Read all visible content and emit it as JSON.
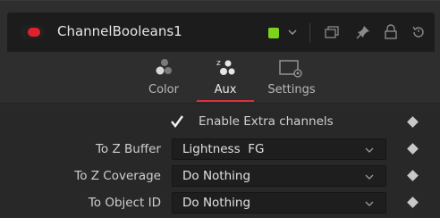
{
  "header": {
    "title": "ChannelBooleans1",
    "node_color": "#7cd31b",
    "power_color": "#e2202b",
    "icons": [
      "power-toggle",
      "color-swatch",
      "chevron-down-icon",
      "versions-icon",
      "pin-icon",
      "lock-icon",
      "reset-icon"
    ]
  },
  "tabs": [
    {
      "label": "Color",
      "icon": "color-channels-icon"
    },
    {
      "label": "Aux",
      "icon": "aux-channels-icon",
      "selected": true
    },
    {
      "label": "Settings",
      "icon": "settings-icon"
    }
  ],
  "accent_color": "#d8303a",
  "enable_extra": {
    "checked": true,
    "label": "Enable Extra channels"
  },
  "fields": [
    {
      "label": "To Z Buffer",
      "value": "Lightness  FG"
    },
    {
      "label": "To Z Coverage",
      "value": "Do Nothing"
    },
    {
      "label": "To Object ID",
      "value": "Do Nothing"
    }
  ]
}
